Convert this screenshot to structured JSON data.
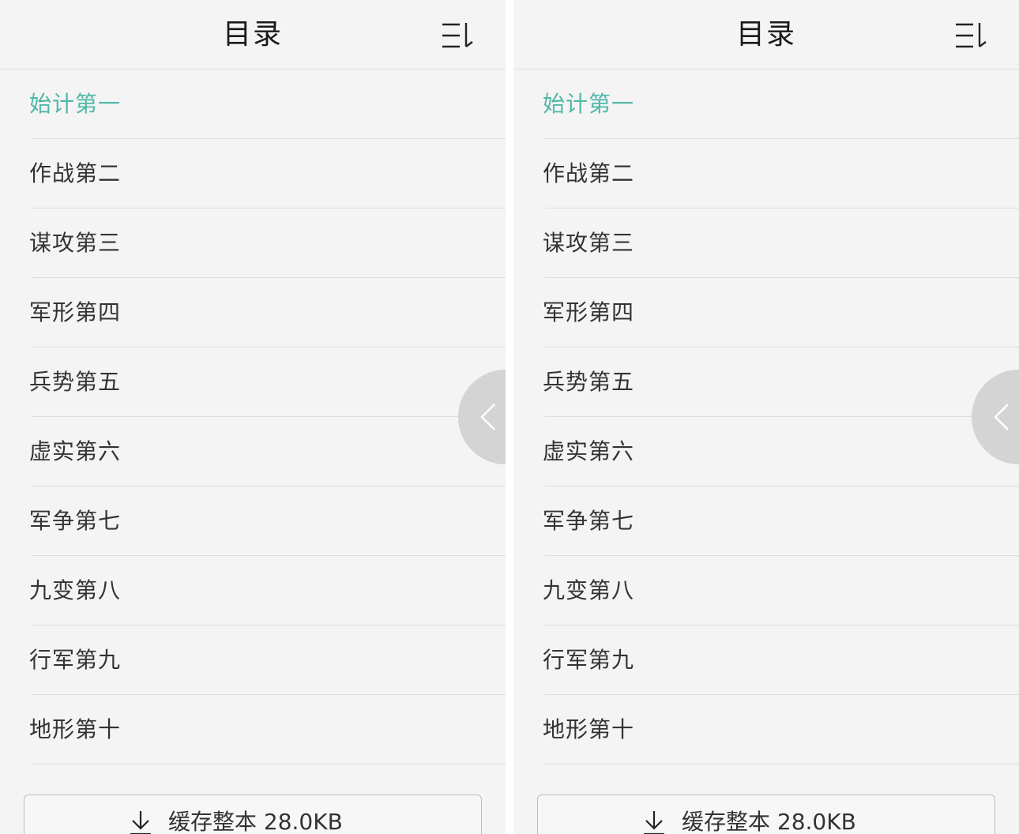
{
  "screens": [
    {
      "header": {
        "title": "目录",
        "sort_icon": "sort-list-icon"
      },
      "chapters": [
        {
          "label": "始计第一",
          "active": true
        },
        {
          "label": "作战第二",
          "active": false
        },
        {
          "label": "谋攻第三",
          "active": false
        },
        {
          "label": "军形第四",
          "active": false
        },
        {
          "label": "兵势第五",
          "active": false
        },
        {
          "label": "虚实第六",
          "active": false
        },
        {
          "label": "军争第七",
          "active": false
        },
        {
          "label": "九变第八",
          "active": false
        },
        {
          "label": "行军第九",
          "active": false
        },
        {
          "label": "地形第十",
          "active": false
        }
      ],
      "side_tab_icon": "chevron-left-icon",
      "download": {
        "label": "缓存整本 28.0KB",
        "icon": "download-icon"
      }
    },
    {
      "header": {
        "title": "目录",
        "sort_icon": "sort-list-icon"
      },
      "chapters": [
        {
          "label": "始计第一",
          "active": true
        },
        {
          "label": "作战第二",
          "active": false
        },
        {
          "label": "谋攻第三",
          "active": false
        },
        {
          "label": "军形第四",
          "active": false
        },
        {
          "label": "兵势第五",
          "active": false
        },
        {
          "label": "虚实第六",
          "active": false
        },
        {
          "label": "军争第七",
          "active": false
        },
        {
          "label": "九变第八",
          "active": false
        },
        {
          "label": "行军第九",
          "active": false
        },
        {
          "label": "地形第十",
          "active": false
        }
      ],
      "side_tab_icon": "chevron-left-icon",
      "download": {
        "label": "缓存整本 28.0KB",
        "icon": "download-icon"
      }
    }
  ],
  "colors": {
    "active_chapter": "#4fb8a8",
    "text": "#333333",
    "background": "#f4f4f4",
    "divider": "#dcdcdc",
    "side_tab": "#d4d4d4"
  }
}
